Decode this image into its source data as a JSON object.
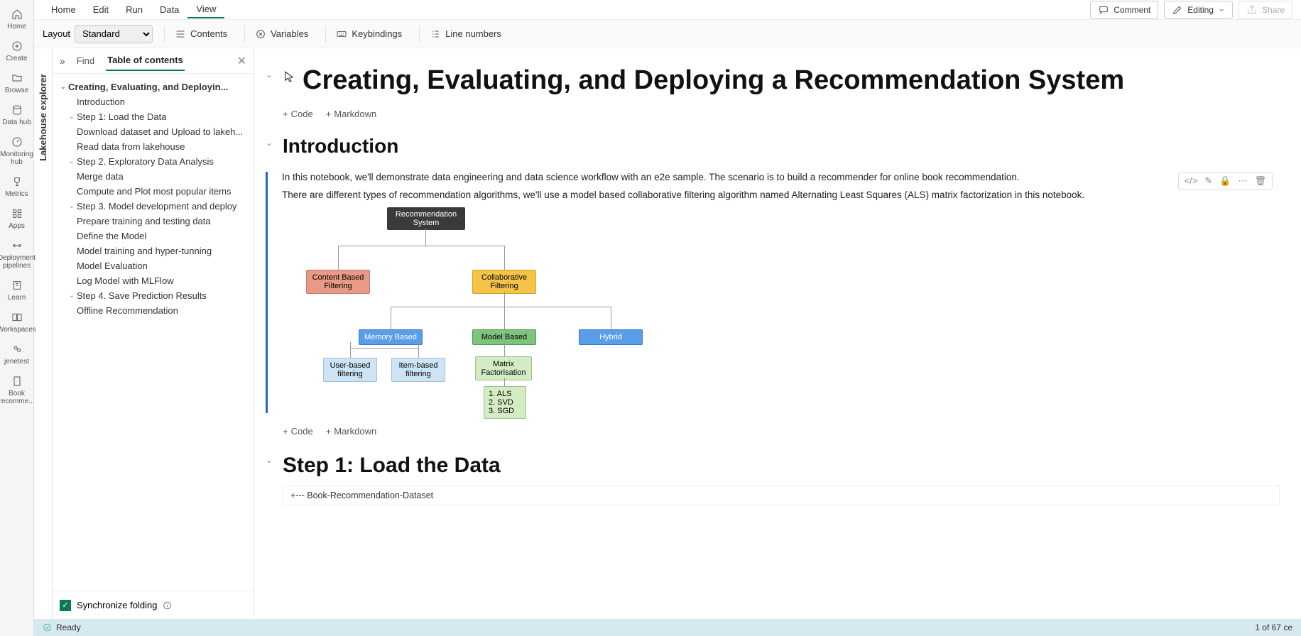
{
  "rail": [
    {
      "label": "Home",
      "icon": "home"
    },
    {
      "label": "Create",
      "icon": "plus-circle"
    },
    {
      "label": "Browse",
      "icon": "folder"
    },
    {
      "label": "Data hub",
      "icon": "data-hub"
    },
    {
      "label": "Monitoring hub",
      "icon": "monitor"
    },
    {
      "label": "Metrics",
      "icon": "trophy"
    },
    {
      "label": "Apps",
      "icon": "apps"
    },
    {
      "label": "Deployment pipelines",
      "icon": "pipeline"
    },
    {
      "label": "Learn",
      "icon": "learn"
    },
    {
      "label": "Workspaces",
      "icon": "workspace"
    },
    {
      "label": "jenetest",
      "icon": "shared"
    },
    {
      "label": "Book recomme...",
      "icon": "doc"
    }
  ],
  "menubar": {
    "tabs": [
      "Home",
      "Edit",
      "Run",
      "Data",
      "View"
    ],
    "active": 4,
    "comment": "Comment",
    "editing": "Editing",
    "share": "Share"
  },
  "toolbar": {
    "layout_label": "Layout",
    "layout_value": "Standard",
    "contents": "Contents",
    "variables": "Variables",
    "keybindings": "Keybindings",
    "linenumbers": "Line numbers"
  },
  "lakehouse": "Lakehouse explorer",
  "toc": {
    "find": "Find",
    "title": "Table of contents",
    "root": "Creating, Evaluating, and Deployin...",
    "items": [
      {
        "lvl": 1,
        "txt": "Introduction"
      },
      {
        "lvl": "1h",
        "txt": "Step 1: Load the Data",
        "chev": true
      },
      {
        "lvl": 2,
        "txt": "Download dataset and Upload to lakeh..."
      },
      {
        "lvl": 2,
        "txt": "Read data from lakehouse"
      },
      {
        "lvl": "1h",
        "txt": "Step 2. Exploratory Data Analysis",
        "chev": true
      },
      {
        "lvl": 2,
        "txt": "Merge data"
      },
      {
        "lvl": 2,
        "txt": "Compute and Plot most popular items"
      },
      {
        "lvl": "1h",
        "txt": "Step 3. Model development and deploy",
        "chev": true
      },
      {
        "lvl": 2,
        "txt": "Prepare training and testing data"
      },
      {
        "lvl": 2,
        "txt": "Define the Model"
      },
      {
        "lvl": 2,
        "txt": "Model training and hyper-tunning"
      },
      {
        "lvl": 2,
        "txt": "Model Evaluation"
      },
      {
        "lvl": 2,
        "txt": "Log Model with MLFlow"
      },
      {
        "lvl": "1h",
        "txt": "Step 4. Save Prediction Results",
        "chev": true
      },
      {
        "lvl": 2,
        "txt": "Offline Recommendation"
      }
    ],
    "sync": "Synchronize folding"
  },
  "nb": {
    "h1": "Creating, Evaluating, and Deploying a Recommendation System",
    "h2_intro": "Introduction",
    "p1": "In this notebook, we'll demonstrate data engineering and data science workflow with an e2e sample. The scenario is to build a recommender for online book recommendation.",
    "p2": "There are different types of recommendation algorithms, we'll use a model based collaborative filtering algorithm named Alternating Least Squares (ALS) matrix factorization in this notebook.",
    "add_code": "Code",
    "add_md": "Markdown",
    "h2_step1": "Step 1: Load the Data",
    "codeline": "+--- Book-Recommendation-Dataset",
    "diagram": {
      "root": "Recommendation System",
      "cbf": "Content Based Filtering",
      "cf": "Collaborative Filtering",
      "mem": "Memory Based",
      "mod": "Model Based",
      "hyb": "Hybrid",
      "ub": "User-based filtering",
      "ib": "Item-based filtering",
      "mf": "Matrix Factorisation",
      "algs": "1. ALS\n2. SVD\n3. SGD"
    }
  },
  "status": {
    "ready": "Ready",
    "cells": "1 of 67 ce"
  }
}
